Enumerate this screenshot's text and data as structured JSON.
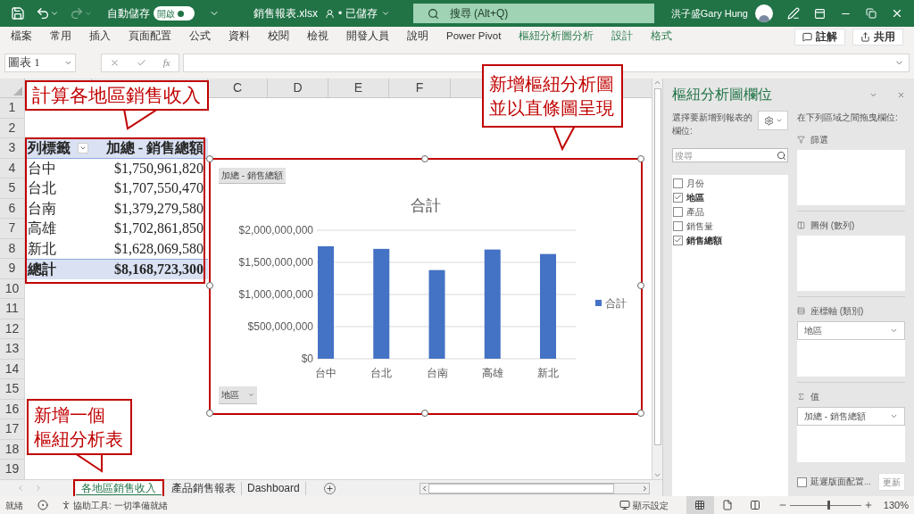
{
  "title_bar": {
    "quick_access": [
      {
        "kind": "save",
        "disabled": false
      },
      {
        "kind": "undo",
        "disabled": false
      },
      {
        "kind": "redo",
        "disabled": true
      }
    ],
    "autosave": {
      "label": "自動儲存",
      "state_text": "開啟",
      "on": true
    },
    "file_name": "銷售報表.xlsx",
    "save_status": "• 已儲存",
    "search": {
      "placeholder": "搜尋 (Alt+Q)"
    },
    "user_name": "洪子盛Gary Hung"
  },
  "ribbon_tabs": [
    {
      "label": "檔案",
      "kind": "standard"
    },
    {
      "label": "常用",
      "kind": "standard"
    },
    {
      "label": "插入",
      "kind": "standard"
    },
    {
      "label": "頁面配置",
      "kind": "standard"
    },
    {
      "label": "公式",
      "kind": "standard"
    },
    {
      "label": "資料",
      "kind": "standard"
    },
    {
      "label": "校閱",
      "kind": "standard"
    },
    {
      "label": "檢視",
      "kind": "standard"
    },
    {
      "label": "開發人員",
      "kind": "standard"
    },
    {
      "label": "說明",
      "kind": "standard"
    },
    {
      "label": "Power Pivot",
      "kind": "standard"
    },
    {
      "label": "樞紐分析圖分析",
      "kind": "contextual"
    },
    {
      "label": "設計",
      "kind": "contextual"
    },
    {
      "label": "格式",
      "kind": "contextual"
    }
  ],
  "ribbon_buttons": [
    {
      "kind": "comment",
      "label": "註解"
    },
    {
      "kind": "share",
      "label": "共用"
    }
  ],
  "formula_bar": {
    "name_box": "圖表 1",
    "function_label": "fx"
  },
  "sheet": {
    "columns": [
      "C",
      "D",
      "E",
      "F"
    ],
    "rows": [
      "1",
      "2",
      "3",
      "4",
      "5",
      "6",
      "7",
      "8",
      "9",
      "10",
      "11",
      "12",
      "13",
      "14",
      "15",
      "16",
      "17",
      "18",
      "19"
    ],
    "pivot_table": {
      "header": [
        "列標籤",
        "加總 - 銷售總額"
      ],
      "rows": [
        {
          "label": "台中",
          "value": "$1,750,961,820"
        },
        {
          "label": "台北",
          "value": "$1,707,550,470"
        },
        {
          "label": "台南",
          "value": "$1,379,279,580"
        },
        {
          "label": "高雄",
          "value": "$1,702,861,850"
        },
        {
          "label": "新北",
          "value": "$1,628,069,580"
        }
      ],
      "total": {
        "label": "總計",
        "value": "$8,168,723,300"
      }
    }
  },
  "chart": {
    "value_field_button": "加總 - 銷售總額",
    "axis_field_button": "地區",
    "chart_data": {
      "type": "bar",
      "title": "合計",
      "categories": [
        "台中",
        "台北",
        "台南",
        "高雄",
        "新北"
      ],
      "series": [
        {
          "name": "合計",
          "color": "#4472c4",
          "values": [
            1750000000,
            1710000000,
            1380000000,
            1700000000,
            1630000000
          ]
        }
      ],
      "grid": true,
      "ylim": [
        0,
        2000000000
      ],
      "yticks": [
        {
          "value": 0,
          "label": "$0"
        },
        {
          "value": 500000000,
          "label": "$500,000,000"
        },
        {
          "value": 1000000000,
          "label": "$1,000,000,000"
        },
        {
          "value": 1500000000,
          "label": "$1,500,000,000"
        },
        {
          "value": 2000000000,
          "label": "$2,000,000,000"
        }
      ]
    }
  },
  "callouts": [
    {
      "kind": "pivot_table",
      "lines": [
        "計算各地區銷售收入"
      ]
    },
    {
      "kind": "chart",
      "lines": [
        "新增樞紐分析圖",
        "並以直條圖呈現"
      ]
    },
    {
      "kind": "sheet_tab",
      "lines": [
        "新增一個",
        "樞紐分析表"
      ]
    }
  ],
  "sheet_tabs": [
    {
      "label": "各地區銷售收入",
      "selected": true
    },
    {
      "label": "產品銷售報表",
      "selected": false
    },
    {
      "label": "Dashboard",
      "selected": false
    }
  ],
  "field_pane": {
    "title": "樞紐分析圖欄位",
    "choose_label": "選擇要新增到報表的欄位:",
    "search": {
      "placeholder": "搜尋"
    },
    "fields": [
      {
        "label": "月份",
        "checked": false
      },
      {
        "label": "地區",
        "checked": true
      },
      {
        "label": "產品",
        "checked": false
      },
      {
        "label": "銷售量",
        "checked": false
      },
      {
        "label": "銷售總額",
        "checked": true
      }
    ],
    "drag_label": "在下列區域之間拖曳欄位:",
    "areas": [
      {
        "kind": "filter",
        "label": "篩選"
      },
      {
        "kind": "legend",
        "label": "圖例 (數列)"
      },
      {
        "kind": "axis",
        "label": "座標軸 (類別)",
        "items": [
          "地區"
        ]
      },
      {
        "kind": "values",
        "label": "值",
        "items": [
          "加總 - 銷售總額"
        ]
      }
    ],
    "defer": {
      "label": "延遲版面配置...",
      "checked": false
    },
    "update_button": {
      "label": "更新",
      "disabled": true
    }
  },
  "status_bar": {
    "ready": "就緒",
    "accessibility": "協助工具: 一切準備就緒",
    "display_settings": "顯示設定",
    "views": [
      {
        "kind": "normal",
        "selected": true
      },
      {
        "kind": "page_layout",
        "selected": false
      },
      {
        "kind": "page_break",
        "selected": false
      }
    ],
    "zoom": {
      "level": 0.55,
      "reading": "130%"
    }
  }
}
